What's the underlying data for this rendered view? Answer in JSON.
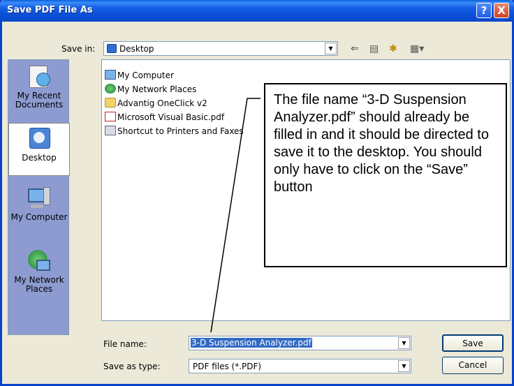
{
  "window": {
    "title": "Save PDF File As"
  },
  "title_buttons": {
    "help": "?",
    "close": "X"
  },
  "save_in": {
    "label": "Save in:",
    "value": "Desktop"
  },
  "places": [
    {
      "label": "My Recent Documents",
      "icon": "recent-documents-icon"
    },
    {
      "label": "Desktop",
      "icon": "desktop-icon"
    },
    {
      "label": "My Computer",
      "icon": "my-computer-icon"
    },
    {
      "label": "My Network Places",
      "icon": "network-places-icon"
    }
  ],
  "files": [
    {
      "name": "My Computer",
      "icon": "my-computer-icon"
    },
    {
      "name": "My Network Places",
      "icon": "network-places-icon"
    },
    {
      "name": "Advantig OneClick v2",
      "icon": "folder-icon"
    },
    {
      "name": "Microsoft Visual Basic.pdf",
      "icon": "pdf-icon"
    },
    {
      "name": "Shortcut to Printers and Faxes",
      "icon": "printers-icon"
    }
  ],
  "annotation": {
    "text": "The file name “3-D Suspension Analyzer.pdf” should already be filled in and it should be directed to save it to the desktop. You should only have to click on the “Save” button"
  },
  "file_name": {
    "label": "File name:",
    "value": "3-D Suspension Analyzer.pdf"
  },
  "save_as_type": {
    "label": "Save as type:",
    "value": "PDF files (*.PDF)"
  },
  "buttons": {
    "save": "Save",
    "cancel": "Cancel"
  },
  "colors": {
    "titlebar": "#0a47c9",
    "places_bg": "#8d9bd0",
    "dialog_bg": "#ece9d8",
    "selection": "#316ac5"
  }
}
